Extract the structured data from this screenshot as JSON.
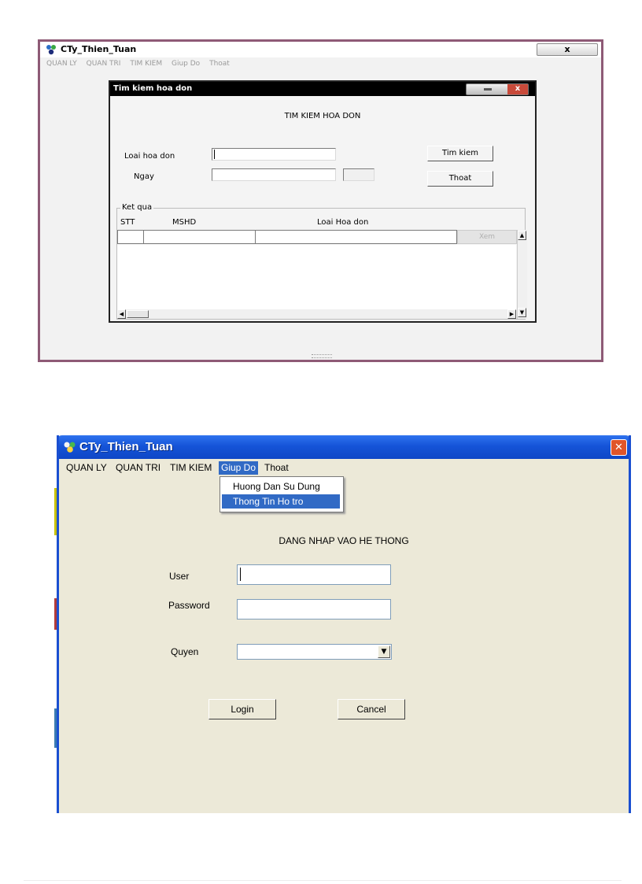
{
  "search_window": {
    "app_title": "CTy_Thien_Tuan",
    "close_glyph": "x",
    "menu": [
      "QUAN LY",
      "QUAN TRI",
      "TIM KIEM",
      "Giup Do",
      "Thoat"
    ],
    "dialog": {
      "title": "Tim kiem hoa don",
      "heading": "TIM KIEM HOA DON",
      "fields": {
        "loai_hoa_don_label": "Loai hoa don",
        "loai_hoa_don_value": "",
        "ngay_label": "Ngay",
        "ngay_value": ""
      },
      "buttons": {
        "search": "Tim kiem",
        "exit": "Thoat",
        "view": "Xem"
      },
      "results": {
        "legend": "Ket qua",
        "columns": [
          "STT",
          "MSHD",
          "Loai Hoa don"
        ],
        "rows": []
      }
    }
  },
  "login_window": {
    "app_title": "CTy_Thien_Tuan",
    "close_glyph": "✕",
    "menu": [
      "QUAN LY",
      "QUAN TRI",
      "TIM KIEM",
      "Giup Do",
      "Thoat"
    ],
    "active_menu": "Giup Do",
    "help_menu_items": [
      "Huong Dan Su Dung",
      "Thong Tin Ho tro"
    ],
    "selected_help_item": "Thong Tin Ho tro",
    "heading": "DANG NHAP VAO HE THONG",
    "fields": {
      "user_label": "User",
      "user_value": "",
      "password_label": "Password",
      "password_value": "",
      "role_label": "Quyen",
      "role_value": ""
    },
    "buttons": {
      "login": "Login",
      "cancel": "Cancel"
    },
    "colors": {
      "title_bar": "#1554d8",
      "menu_highlight": "#316ac5",
      "background": "#ece9d8"
    }
  },
  "icons": [
    "app-icon",
    "close-icon",
    "minimize-icon",
    "dropdown-arrow-icon",
    "scroll-up-icon",
    "scroll-down-icon",
    "scroll-left-icon",
    "scroll-right-icon"
  ]
}
